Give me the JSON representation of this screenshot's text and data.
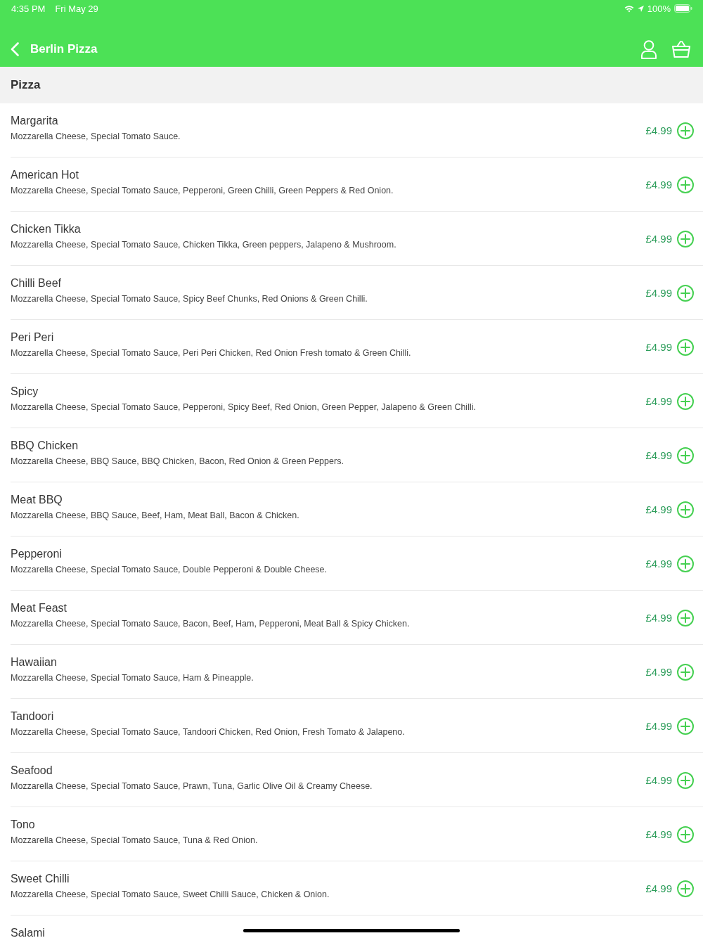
{
  "status_bar": {
    "time": "4:35 PM",
    "date": "Fri May 29",
    "battery": "100%"
  },
  "nav_bar": {
    "title": "Berlin Pizza"
  },
  "section": {
    "title": "Pizza"
  },
  "items": [
    {
      "name": "Margarita",
      "description": "Mozzarella Cheese, Special Tomato Sauce.",
      "price": "£4.99"
    },
    {
      "name": "American Hot",
      "description": "Mozzarella Cheese, Special Tomato Sauce, Pepperoni, Green Chilli, Green Peppers & Red Onion.",
      "price": "£4.99"
    },
    {
      "name": "Chicken Tikka",
      "description": "Mozzarella Cheese, Special Tomato Sauce, Chicken Tikka, Green peppers, Jalapeno & Mushroom.",
      "price": "£4.99"
    },
    {
      "name": "Chilli Beef",
      "description": "Mozzarella Cheese, Special Tomato Sauce, Spicy Beef Chunks, Red Onions & Green Chilli.",
      "price": "£4.99"
    },
    {
      "name": "Peri Peri",
      "description": "Mozzarella Cheese, Special Tomato Sauce, Peri Peri Chicken, Red Onion Fresh tomato & Green Chilli.",
      "price": "£4.99"
    },
    {
      "name": "Spicy",
      "description": "Mozzarella Cheese, Special Tomato Sauce, Pepperoni, Spicy Beef, Red Onion, Green Pepper, Jalapeno & Green Chilli.",
      "price": "£4.99"
    },
    {
      "name": "BBQ Chicken",
      "description": "Mozzarella Cheese, BBQ Sauce, BBQ Chicken, Bacon, Red Onion & Green Peppers.",
      "price": "£4.99"
    },
    {
      "name": "Meat BBQ",
      "description": "Mozzarella Cheese, BBQ Sauce, Beef, Ham, Meat Ball, Bacon & Chicken.",
      "price": "£4.99"
    },
    {
      "name": "Pepperoni",
      "description": "Mozzarella Cheese, Special Tomato Sauce, Double Pepperoni & Double Cheese.",
      "price": "£4.99"
    },
    {
      "name": "Meat Feast",
      "description": "Mozzarella Cheese, Special Tomato Sauce, Bacon, Beef, Ham, Pepperoni, Meat Ball & Spicy Chicken.",
      "price": "£4.99"
    },
    {
      "name": "Hawaiian",
      "description": "Mozzarella Cheese, Special Tomato Sauce, Ham & Pineapple.",
      "price": "£4.99"
    },
    {
      "name": "Tandoori",
      "description": "Mozzarella Cheese, Special Tomato Sauce, Tandoori Chicken, Red Onion, Fresh Tomato & Jalapeno.",
      "price": "£4.99"
    },
    {
      "name": "Seafood",
      "description": "Mozzarella Cheese, Special Tomato Sauce, Prawn, Tuna, Garlic Olive Oil & Creamy Cheese.",
      "price": "£4.99"
    },
    {
      "name": "Tono",
      "description": "Mozzarella Cheese, Special Tomato Sauce, Tuna & Red Onion.",
      "price": "£4.99"
    },
    {
      "name": "Sweet Chilli",
      "description": "Mozzarella Cheese, Special Tomato Sauce, Sweet Chilli Sauce, Chicken & Onion.",
      "price": "£4.99"
    },
    {
      "name": "Salami"
    }
  ]
}
